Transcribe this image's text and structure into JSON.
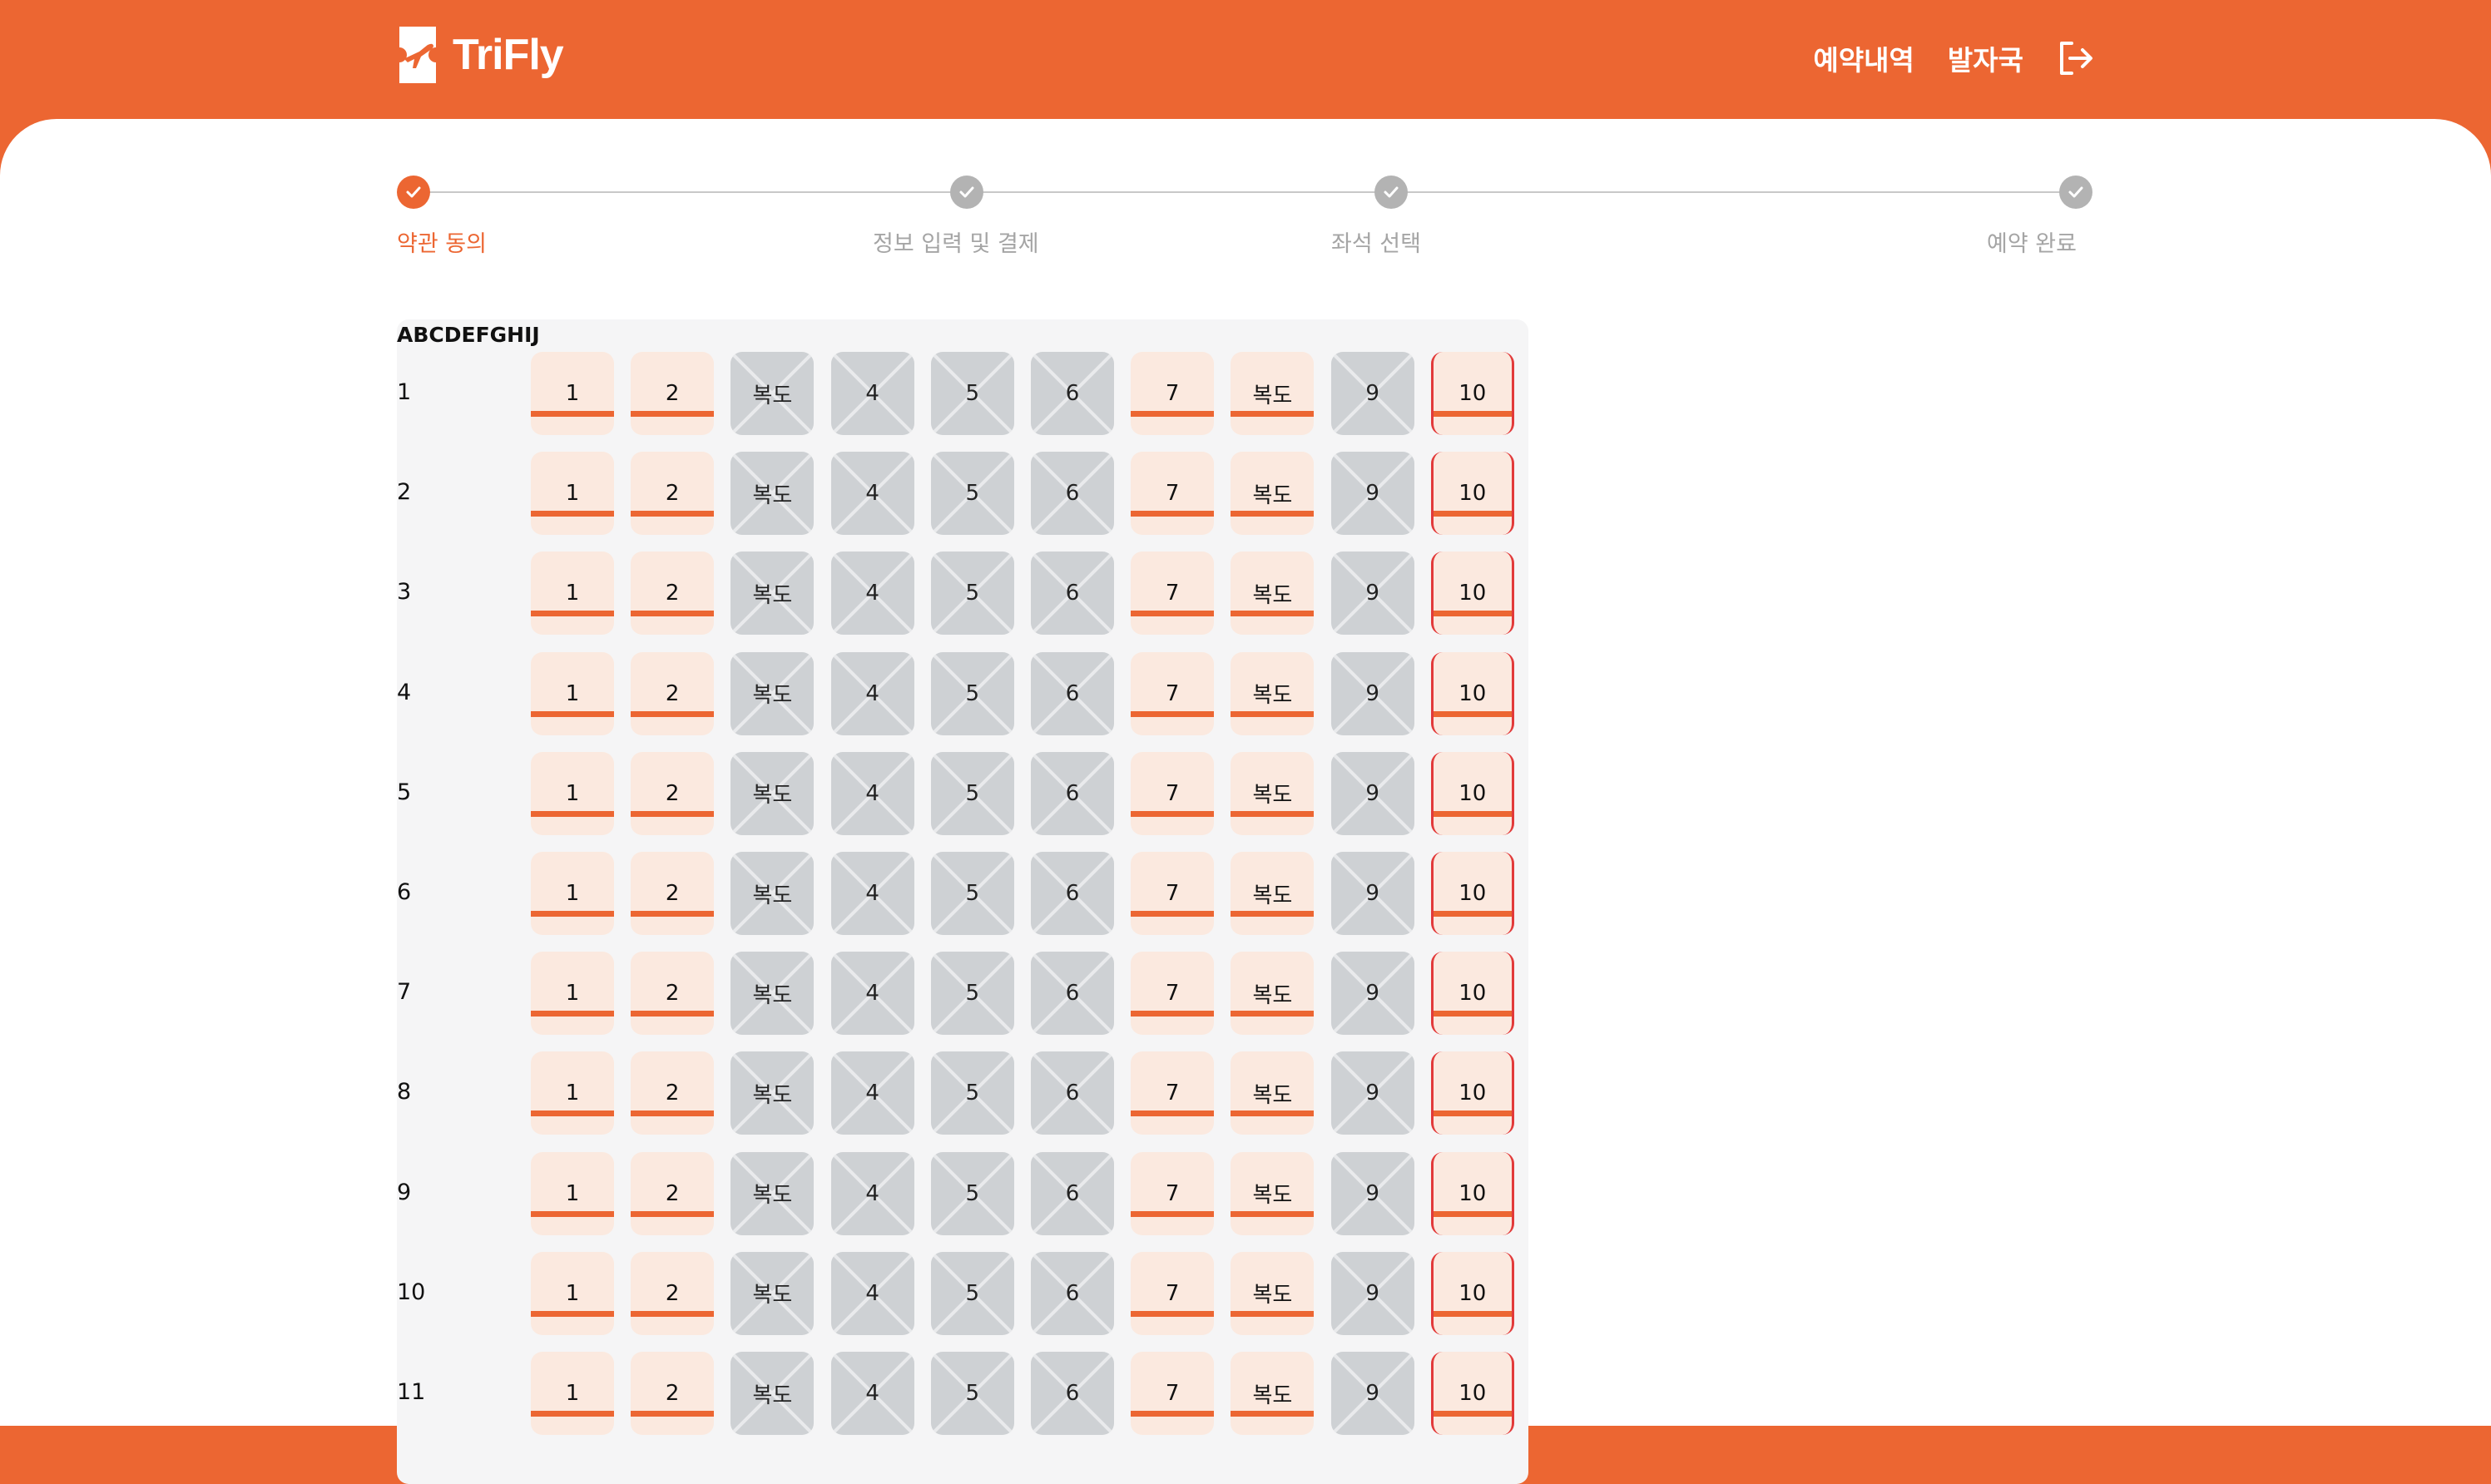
{
  "header": {
    "logo_text": "TriFly",
    "nav": {
      "reservations": "예약내역",
      "departure": "발자국"
    }
  },
  "steps": [
    {
      "label": "약관 동의",
      "active": true
    },
    {
      "label": "정보 입력 및 결제",
      "active": false
    },
    {
      "label": "좌석 선택",
      "active": false
    },
    {
      "label": "예약 완료",
      "active": false
    }
  ],
  "seatmap": {
    "column_header": "ABCDEFGHIJ",
    "rows": [
      "1",
      "2",
      "3",
      "4",
      "5",
      "6",
      "7",
      "8",
      "9",
      "10",
      "11"
    ],
    "seats": [
      {
        "label": "1",
        "state": "available"
      },
      {
        "label": "2",
        "state": "available"
      },
      {
        "label": "복도",
        "state": "blocked"
      },
      {
        "label": "4",
        "state": "blocked"
      },
      {
        "label": "5",
        "state": "blocked"
      },
      {
        "label": "6",
        "state": "blocked"
      },
      {
        "label": "7",
        "state": "available"
      },
      {
        "label": "복도",
        "state": "available"
      },
      {
        "label": "9",
        "state": "blocked"
      },
      {
        "label": "10",
        "state": "available-edge"
      }
    ]
  },
  "colors": {
    "brand": "#ec6632",
    "available_bg": "#fbe9df",
    "blocked_bg": "#ced1d4"
  }
}
